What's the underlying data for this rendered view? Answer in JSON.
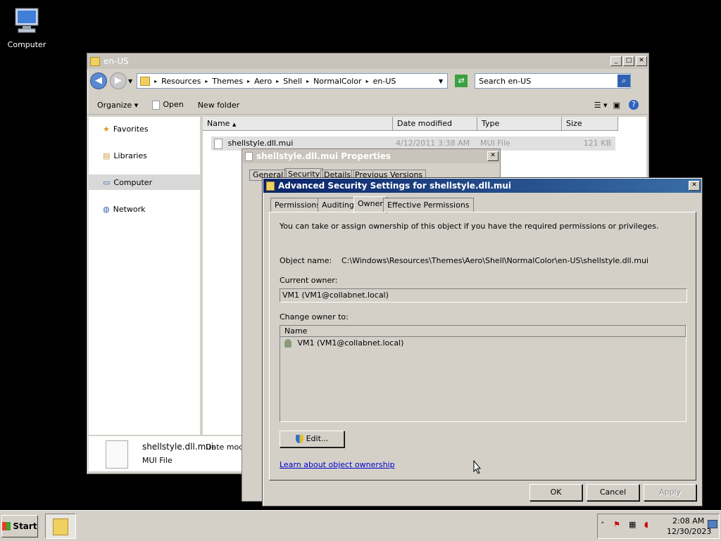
{
  "desktop": {
    "computer_label": "Computer"
  },
  "explorer": {
    "title": "en-US",
    "breadcrumbs": [
      "Resources",
      "Themes",
      "Aero",
      "Shell",
      "NormalColor",
      "en-US"
    ],
    "search_placeholder": "Search en-US",
    "toolbar": {
      "organize": "Organize",
      "open": "Open",
      "new_folder": "New folder"
    },
    "nav": {
      "favorites": "Favorites",
      "libraries": "Libraries",
      "computer": "Computer",
      "network": "Network"
    },
    "columns": {
      "name": "Name",
      "date": "Date modified",
      "type": "Type",
      "size": "Size"
    },
    "file": {
      "name": "shellstyle.dll.mui",
      "date": "4/12/2011 3:38 AM",
      "type": "MUI File",
      "size": "121 KB"
    },
    "details": {
      "name": "shellstyle.dll.mui",
      "type": "MUI File",
      "date_label": "Date modifi"
    }
  },
  "props": {
    "title": "shellstyle.dll.mui Properties",
    "tabs": [
      "General",
      "Security",
      "Details",
      "Previous Versions"
    ]
  },
  "adv": {
    "title": "Advanced Security Settings for shellstyle.dll.mui",
    "tabs": [
      "Permissions",
      "Auditing",
      "Owner",
      "Effective Permissions"
    ],
    "intro": "You can take or assign ownership of this object if you have the required permissions or privileges.",
    "object_name_label": "Object name:",
    "object_name": "C:\\Windows\\Resources\\Themes\\Aero\\Shell\\NormalColor\\en-US\\shellstyle.dll.mui",
    "current_owner_label": "Current owner:",
    "current_owner": "VM1 (VM1@collabnet.local)",
    "change_owner_label": "Change owner to:",
    "list_header": "Name",
    "owners": [
      "VM1 (VM1@collabnet.local)"
    ],
    "edit": "Edit...",
    "learn_link": "Learn about object ownership",
    "ok": "OK",
    "cancel": "Cancel",
    "apply": "Apply"
  },
  "taskbar": {
    "start": "Start",
    "time": "2:08 AM",
    "date": "12/30/2023"
  }
}
